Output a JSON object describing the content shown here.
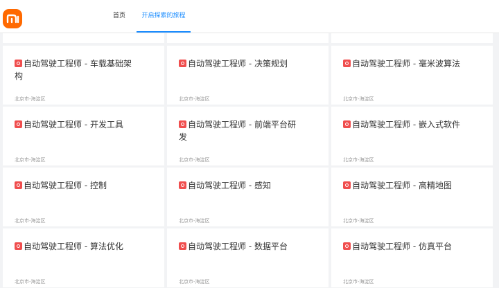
{
  "header": {
    "logo_text": "mi",
    "tabs": [
      {
        "label": "首页",
        "active": false
      },
      {
        "label": "开启探索的旅程",
        "active": true
      }
    ]
  },
  "colors": {
    "brand": "#ff6900",
    "accent": "#1a8cff",
    "badge": "#f04e4e"
  },
  "jobs": [
    {
      "title": "自动驾驶工程师 - 车载基础架构",
      "location": "北京市-海淀区"
    },
    {
      "title": "自动驾驶工程师 - 决策规划",
      "location": "北京市-海淀区"
    },
    {
      "title": "自动驾驶工程师 - 毫米波算法",
      "location": "北京市-海淀区"
    },
    {
      "title": "自动驾驶工程师 - 开发工具",
      "location": "北京市-海淀区"
    },
    {
      "title": "自动驾驶工程师 - 前端平台研发",
      "location": "北京市-海淀区"
    },
    {
      "title": "自动驾驶工程师 - 嵌入式软件",
      "location": "北京市-海淀区"
    },
    {
      "title": "自动驾驶工程师 - 控制",
      "location": "北京市-海淀区"
    },
    {
      "title": "自动驾驶工程师 - 感知",
      "location": "北京市-海淀区"
    },
    {
      "title": "自动驾驶工程师 - 高精地图",
      "location": "北京市-海淀区"
    },
    {
      "title": "自动驾驶工程师 - 算法优化",
      "location": "北京市-海淀区"
    },
    {
      "title": "自动驾驶工程师 - 数据平台",
      "location": "北京市-海淀区"
    },
    {
      "title": "自动驾驶工程师 - 仿真平台",
      "location": "北京市-海淀区"
    }
  ]
}
